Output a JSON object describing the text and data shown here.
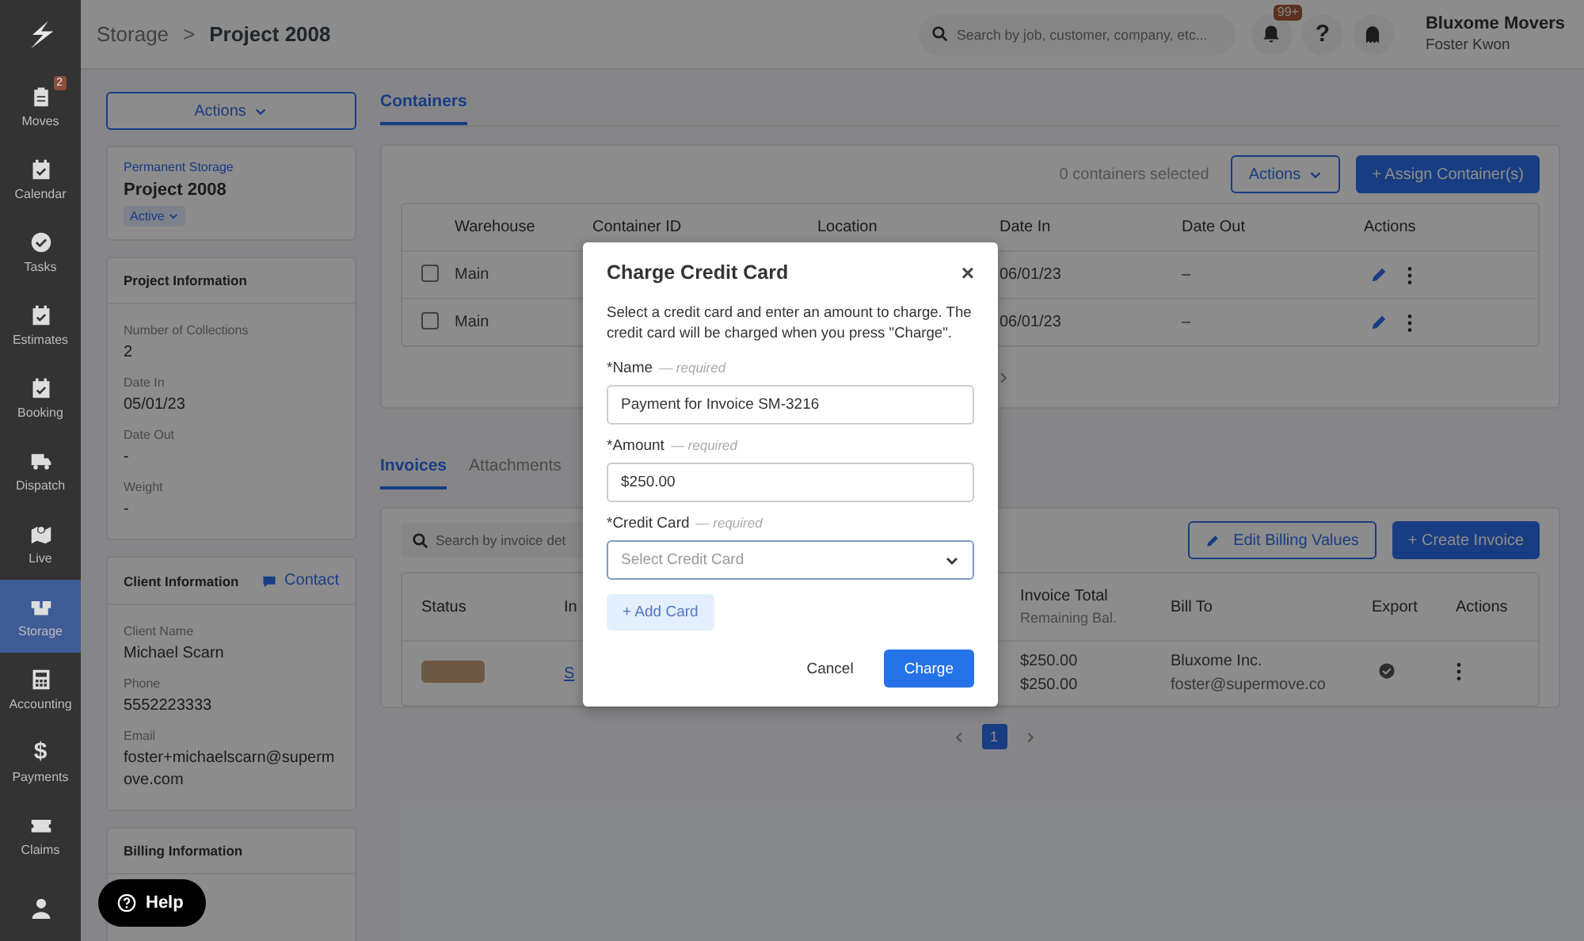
{
  "sidebar": {
    "items": [
      {
        "label": "Moves",
        "badge": "2",
        "selected": false
      },
      {
        "label": "Calendar",
        "selected": false
      },
      {
        "label": "Tasks",
        "selected": false
      },
      {
        "label": "Estimates",
        "selected": false
      },
      {
        "label": "Booking",
        "selected": false
      },
      {
        "label": "Dispatch",
        "selected": false
      },
      {
        "label": "Live",
        "selected": false
      },
      {
        "label": "Storage",
        "selected": true
      },
      {
        "label": "Accounting",
        "selected": false
      },
      {
        "label": "Payments",
        "glyph": "$",
        "selected": false
      },
      {
        "label": "Claims",
        "selected": false
      },
      {
        "selected": false
      }
    ]
  },
  "header": {
    "breadcrumb": {
      "parent": "Storage",
      "separator": ">",
      "current": "Project 2008"
    },
    "search": {
      "placeholder": "Search by job, customer, company, etc..."
    },
    "notification_badge": "99+",
    "help_glyph": "?",
    "organization": "Bluxome Movers",
    "user": "Foster Kwon"
  },
  "project_panel": {
    "actions_button": "Actions",
    "project": {
      "type": "Permanent Storage",
      "name": "Project 2008",
      "status": "Active"
    },
    "sections": [
      {
        "title": "Project Information",
        "fields": [
          {
            "label": "Number of Collections",
            "value": "2"
          },
          {
            "label": "Date In",
            "value": "05/01/23"
          },
          {
            "label": "Date Out",
            "value": "-"
          },
          {
            "label": "Weight",
            "value": "-"
          }
        ]
      },
      {
        "title": "Client Information",
        "link": "Contact",
        "fields": [
          {
            "label": "Client Name",
            "value": "Michael Scarn"
          },
          {
            "label": "Phone",
            "value": "5552223333"
          },
          {
            "label": "Email",
            "value": "foster+michaelscarn@supermove.com"
          }
        ]
      },
      {
        "title": "Billing Information"
      }
    ]
  },
  "containers": {
    "tabs": [
      {
        "label": "Containers",
        "selected": true
      }
    ],
    "selected_count": "0 containers selected",
    "actions_button": "Actions",
    "assign_button": "+ Assign Container(s)",
    "columns": [
      "Warehouse",
      "Container ID",
      "Location",
      "Date In",
      "Date Out",
      "Actions"
    ],
    "rows": [
      {
        "checked": false,
        "warehouse": "Main",
        "date_in": "06/01/23",
        "date_out": "–"
      },
      {
        "checked": false,
        "warehouse": "Main",
        "date_in": "06/01/23",
        "date_out": "–"
      }
    ]
  },
  "invoices": {
    "tabs": [
      {
        "label": "Invoices",
        "selected": true
      },
      {
        "label": "Attachments",
        "selected": false
      }
    ],
    "search": {
      "placeholder": "Search by invoice det"
    },
    "edit_button": "Edit Billing Values",
    "create_button": "+ Create Invoice",
    "columns": [
      {
        "label": "Status"
      },
      {
        "label": "In"
      },
      {
        "label": "Invoice Total",
        "sublabel": "Remaining Bal."
      },
      {
        "label": "Bill To"
      },
      {
        "label": "Export"
      },
      {
        "label": "Actions"
      }
    ],
    "rows": [
      {
        "invoice_link": "S",
        "total": "$250.00",
        "remaining": "$250.00",
        "bill_to": "Bluxome Inc.",
        "email": "foster@supermove.co",
        "exported": true
      }
    ],
    "pagination": {
      "page": "1"
    }
  },
  "help_button": "Help",
  "modal": {
    "title": "Charge Credit Card",
    "close": "×",
    "description": "Select a credit card and enter an amount to charge. The credit card will be charged when you press \"Charge\".",
    "fields": [
      {
        "kind": "text",
        "label": "*Name",
        "hint": "— required",
        "value": "Payment for Invoice SM-3216"
      },
      {
        "kind": "text",
        "label": "*Amount",
        "hint": "— required",
        "value": "$250.00"
      },
      {
        "kind": "select",
        "label": "*Credit Card",
        "hint": "— required",
        "placeholder": "Select Credit Card"
      }
    ],
    "add_card_button": "+ Add Card",
    "cancel_button": "Cancel",
    "submit_button": "Charge"
  }
}
